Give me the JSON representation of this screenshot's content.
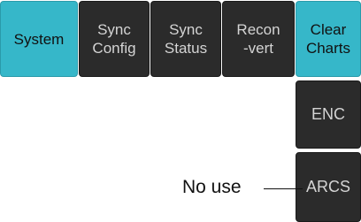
{
  "tabs": [
    {
      "label": "System",
      "active": true
    },
    {
      "label_line1": "Sync",
      "label_line2": "Config"
    },
    {
      "label_line1": "Sync",
      "label_line2": "Status"
    },
    {
      "label_line1": "Recon",
      "label_line2": "-vert"
    }
  ],
  "side_menu": {
    "clear_charts_line1": "Clear",
    "clear_charts_line2": "Charts",
    "enc_label": "ENC",
    "arcs_label": "ARCS"
  },
  "annotation": {
    "text": "No use"
  },
  "colors": {
    "active_bg": "#36b7c9",
    "button_bg": "#2b2b2b",
    "button_text": "#d4d4d4"
  }
}
